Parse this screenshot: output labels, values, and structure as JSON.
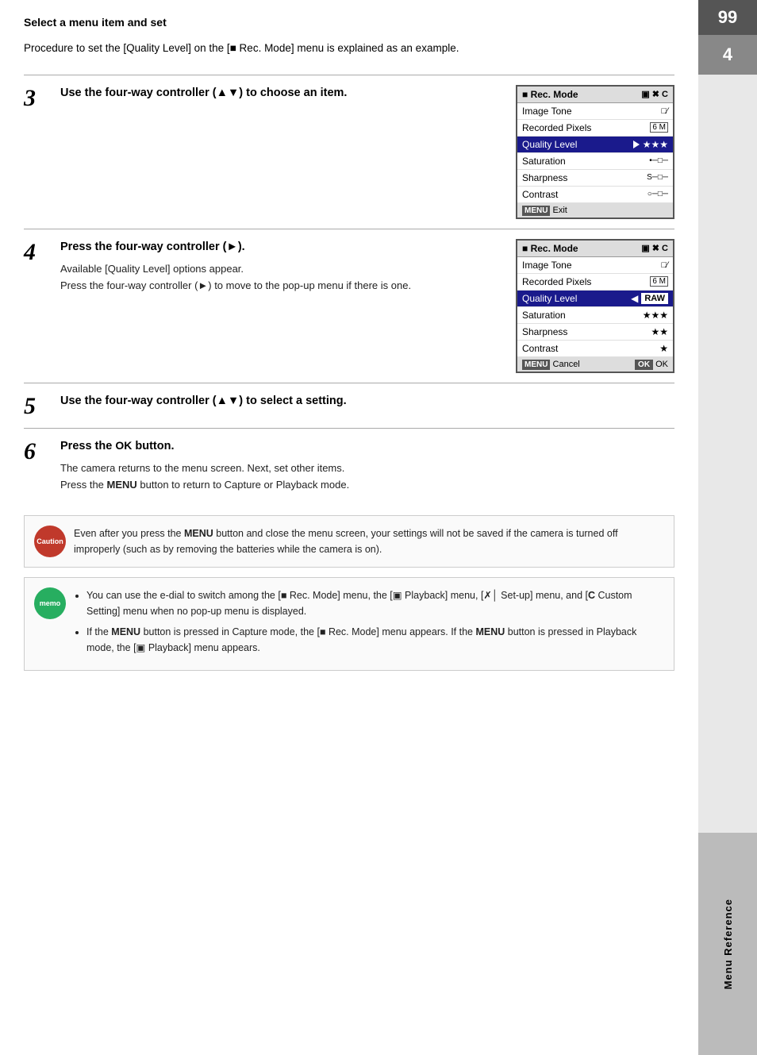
{
  "page": {
    "number": "99",
    "chapter_number": "4",
    "chapter_label": "Menu Reference"
  },
  "section_title": "Select a menu item and set",
  "intro": "Procedure to set the [Quality Level] on the [■ Rec. Mode] menu is explained as an example.",
  "steps": [
    {
      "number": "3",
      "title": "Use the four-way controller (▲▼) to choose an item.",
      "desc": "",
      "has_image": true,
      "image_id": "menu1"
    },
    {
      "number": "4",
      "title": "Press the four-way controller (►).",
      "desc": "Available [Quality Level] options appear.\nPress the four-way controller (►) to move to the pop-up menu if there is one.",
      "has_image": true,
      "image_id": "menu2"
    },
    {
      "number": "5",
      "title": "Use the four-way controller (▲▼) to select a setting.",
      "desc": "",
      "has_image": false
    },
    {
      "number": "6",
      "title": "Press the OK button.",
      "desc": "The camera returns to the menu screen. Next, set other items.\nPress the MENU button to return to Capture or Playback mode.",
      "has_image": false
    }
  ],
  "menu1": {
    "header": "■ Rec. Mode",
    "icons": "▣✖C",
    "rows": [
      {
        "label": "Image Tone",
        "value": "□□",
        "highlighted": false
      },
      {
        "label": "Recorded Pixels",
        "value": "6M",
        "highlighted": false
      },
      {
        "label": "Quality Level",
        "value": "►★★★",
        "highlighted": true
      },
      {
        "label": "Saturation",
        "value": "•-□-",
        "highlighted": false
      },
      {
        "label": "Sharpness",
        "value": "S-□-",
        "highlighted": false
      },
      {
        "label": "Contrast",
        "value": "○-□-",
        "highlighted": false
      }
    ],
    "footer_left": "MENU Exit",
    "footer_right": ""
  },
  "menu2": {
    "header": "■ Rec. Mode",
    "icons": "▣✖C",
    "rows": [
      {
        "label": "Image Tone",
        "value": "□□",
        "highlighted": false
      },
      {
        "label": "Recorded Pixels",
        "value": "6M",
        "highlighted": false
      },
      {
        "label": "Quality Level",
        "value": "RAW",
        "highlighted": true,
        "triangle_left": true
      },
      {
        "label": "Saturation",
        "value": "★★★",
        "highlighted": false
      },
      {
        "label": "Sharpness",
        "value": "★★",
        "highlighted": false
      },
      {
        "label": "Contrast",
        "value": "★",
        "highlighted": false
      }
    ],
    "footer_left": "MENU Cancel",
    "footer_right": "OK OK"
  },
  "caution_box": {
    "label": "Caution",
    "text": "Even after you press the MENU button and close the menu screen, your settings will not be saved if the camera is turned off improperly (such as by removing the batteries while the camera is on)."
  },
  "memo_box": {
    "label": "memo",
    "items": [
      "You can use the e-dial to switch among the [■ Rec. Mode] menu, the [▣ Playback] menu, [✗│ Set-up] menu, and [C Custom Setting] menu when no pop-up menu is displayed.",
      "If the MENU button is pressed in Capture mode, the [■ Rec. Mode] menu appears. If the MENU button is pressed in Playback mode, the [▣ Playback] menu appears."
    ]
  }
}
